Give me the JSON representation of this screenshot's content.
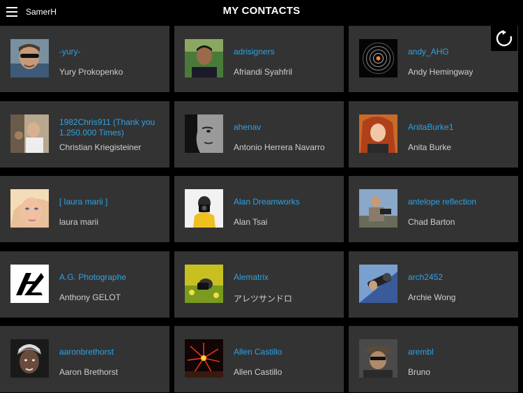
{
  "header": {
    "username": "SamerH",
    "title": "MY CONTACTS"
  },
  "icons": {
    "menu": "hamburger-menu-icon",
    "refresh": "refresh-icon"
  },
  "contacts": [
    {
      "username": "-yury-",
      "name": "Yury Prokopenko"
    },
    {
      "username": "adrisigners",
      "name": "Afriandi Syahfril"
    },
    {
      "username": "andy_AHG",
      "name": "Andy Hemingway"
    },
    {
      "username": "1982Chris911 (Thank you 1.250.000 Times)",
      "name": "Christian Kriegisteiner"
    },
    {
      "username": "ahenav",
      "name": "Antonio Herrera Navarro"
    },
    {
      "username": "AnitaBurke1",
      "name": "Anita Burke"
    },
    {
      "username": "[ laura marii ]",
      "name": "laura marii"
    },
    {
      "username": "Alan Dreamworks",
      "name": "Alan Tsai"
    },
    {
      "username": "antelope reflection",
      "name": "Chad Barton"
    },
    {
      "username": "A.G. Photographe",
      "name": "Anthony GELOT"
    },
    {
      "username": "Alematrix",
      "name": "アレツサンドロ"
    },
    {
      "username": "arch2452",
      "name": "Archie Wong"
    },
    {
      "username": "aaronbrethorst",
      "name": "Aaron Brethorst"
    },
    {
      "username": "Allen Castillo",
      "name": "Allen Castillo"
    },
    {
      "username": "arembl",
      "name": "Bruno"
    }
  ]
}
